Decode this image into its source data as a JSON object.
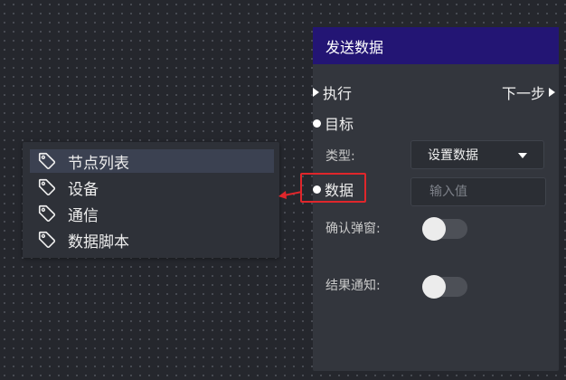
{
  "dropdown": {
    "items": [
      {
        "label": "节点列表",
        "selected": true
      },
      {
        "label": "设备",
        "selected": false
      },
      {
        "label": "通信",
        "selected": false
      },
      {
        "label": "数据脚本",
        "selected": false
      }
    ],
    "icon": "tag-icon"
  },
  "node": {
    "title": "发送数据",
    "header_color": "#231574",
    "exec_in_label": "执行",
    "exec_out_label": "下一步",
    "target_label": "目标",
    "type_label": "类型:",
    "type_value": "设置数据",
    "data_label": "数据",
    "data_placeholder": "输入值",
    "confirm_label": "确认弹窗:",
    "confirm_on": false,
    "notify_label": "结果通知:",
    "notify_on": false
  },
  "annotation": {
    "highlight_color": "#e0262b"
  }
}
